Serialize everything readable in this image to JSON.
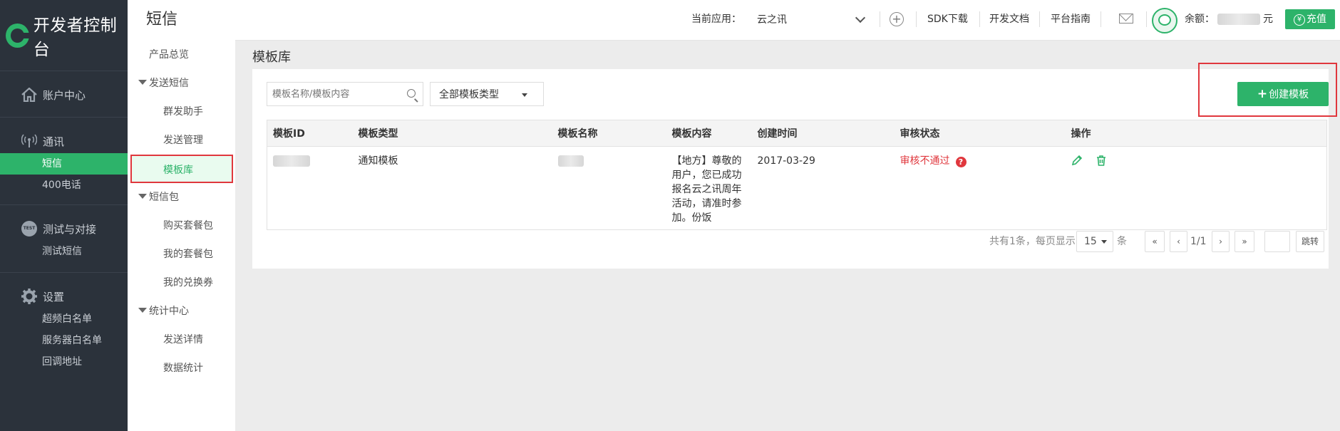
{
  "brand": {
    "logo_text": "开发者控制台"
  },
  "leftnav": {
    "groups": [
      {
        "icon": "home-icon",
        "label": "账户中心",
        "items": []
      },
      {
        "icon": "signal-icon",
        "label": "通讯",
        "items": [
          {
            "label": "短信",
            "active": true
          },
          {
            "label": "400电话",
            "active": false
          }
        ]
      },
      {
        "icon": "test-icon",
        "icon_text": "TEST",
        "label": "测试与对接",
        "items": [
          {
            "label": "测试短信",
            "active": false
          }
        ]
      },
      {
        "icon": "gear-icon",
        "label": "设置",
        "items": [
          {
            "label": "超频白名单",
            "active": false
          },
          {
            "label": "服务器白名单",
            "active": false
          },
          {
            "label": "回调地址",
            "active": false
          }
        ]
      }
    ]
  },
  "subnav": {
    "title": "短信",
    "items": [
      {
        "label": "产品总览",
        "kind": "top"
      },
      {
        "label": "发送短信",
        "kind": "group"
      },
      {
        "label": "群发助手",
        "kind": "sub"
      },
      {
        "label": "发送管理",
        "kind": "sub"
      },
      {
        "label": "模板库",
        "kind": "sub",
        "active": true
      },
      {
        "label": "短信包",
        "kind": "group"
      },
      {
        "label": "购买套餐包",
        "kind": "sub"
      },
      {
        "label": "我的套餐包",
        "kind": "sub"
      },
      {
        "label": "我的兑换券",
        "kind": "sub"
      },
      {
        "label": "统计中心",
        "kind": "group"
      },
      {
        "label": "发送详情",
        "kind": "sub"
      },
      {
        "label": "数据统计",
        "kind": "sub"
      }
    ]
  },
  "topbar": {
    "current_app_label": "当前应用：",
    "current_app_value": "云之讯",
    "sdk": "SDK下载",
    "docs": "开发文档",
    "guide": "平台指南",
    "balance_label": "余额：",
    "balance_unit": "元",
    "recharge": "充值",
    "recharge_symbol": "¥"
  },
  "main": {
    "title": "模板库",
    "search_placeholder": "模板名称/模板内容",
    "type_filter": "全部模板类型",
    "create_button": "创建模板",
    "create_button_prefix": "+",
    "table": {
      "headers": [
        "模板ID",
        "模板类型",
        "模板名称",
        "模板内容",
        "创建时间",
        "审核状态",
        "操作"
      ],
      "rows": [
        {
          "type": "通知模板",
          "content": "【地方】尊敬的用户，您已成功报名云之讯周年活动，请准时参加。份饭",
          "created": "2017-03-29",
          "status": "审核不通过",
          "status_help": "?"
        }
      ]
    },
    "pager": {
      "summary_prefix": "共有1条，每页显示",
      "page_size": "15",
      "summary_suffix": "条",
      "first": "«",
      "prev": "‹",
      "page_info": "1/1",
      "next": "›",
      "last": "»",
      "jump_value": "",
      "jump": "跳转"
    }
  },
  "colors": {
    "accent": "#2db36a",
    "nav_bg": "#2b323b",
    "highlight": "#e0373d"
  }
}
